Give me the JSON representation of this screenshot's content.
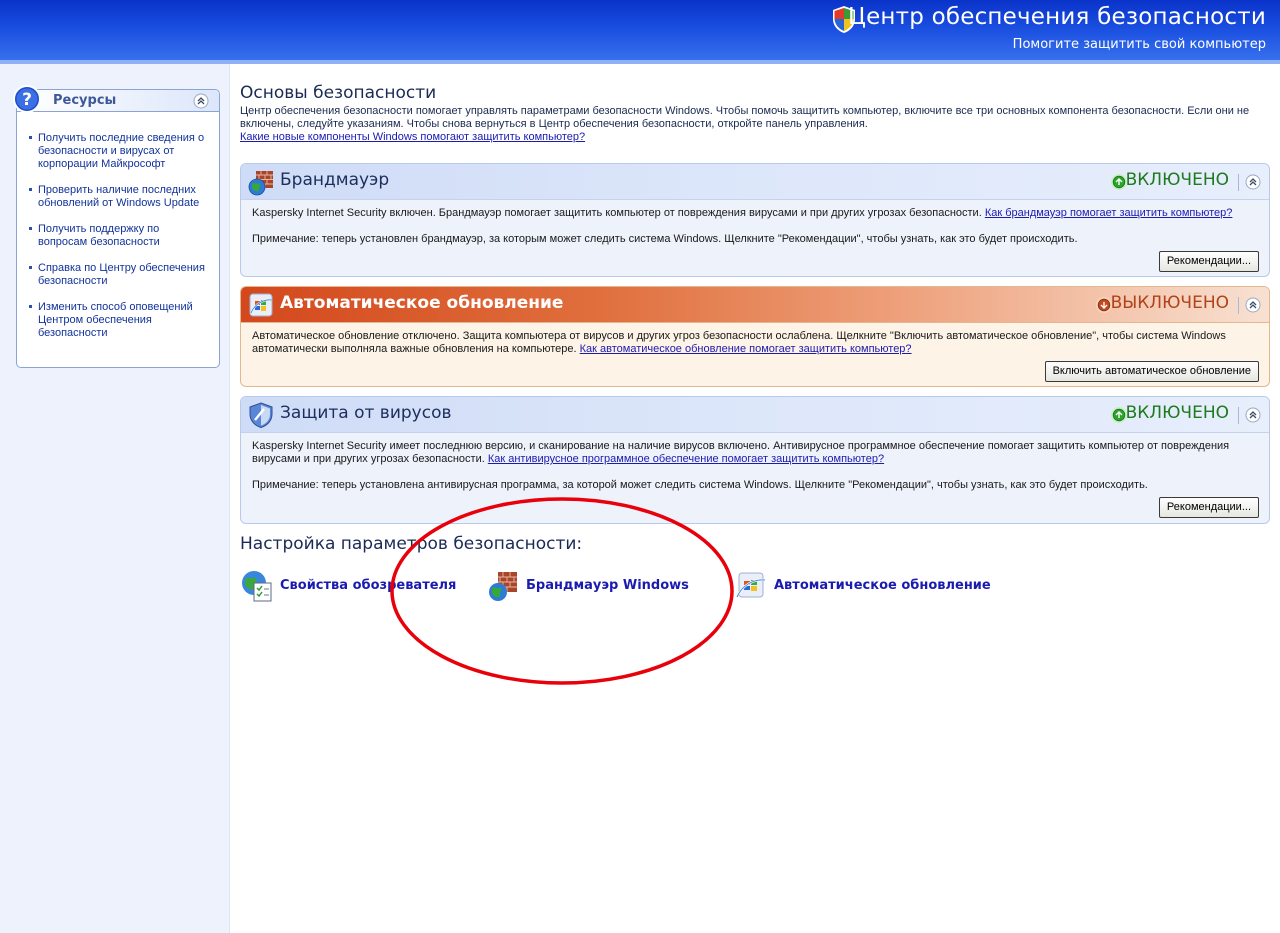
{
  "header": {
    "title": "Центр обеспечения безопасности",
    "subtitle": "Помогите защитить свой компьютер"
  },
  "resources": {
    "title": "Ресурсы",
    "items": [
      {
        "label": "Получить последние сведения о безопасности и вирусах от корпорации Майкрософт"
      },
      {
        "label": "Проверить наличие последних обновлений от Windows Update"
      },
      {
        "label": "Получить поддержку по вопросам безопасности"
      },
      {
        "label": "Справка по Центру обеспечения безопасности"
      },
      {
        "label": "Изменить способ оповещений Центром обеспечения безопасности"
      }
    ]
  },
  "main": {
    "title": "Основы безопасности",
    "description": "Центр обеспечения безопасности помогает управлять параметрами безопасности Windows. Чтобы помочь защитить компьютер, включите все три основных компонента безопасности. Если они не включены, следуйте указаниям. Чтобы снова вернуться в Центр обеспечения безопасности, откройте панель управления.",
    "link": "Какие новые компоненты Windows помогают защитить компьютер?"
  },
  "panels": {
    "firewall": {
      "title": "Брандмауэр",
      "status": "ВКЛЮЧЕНО",
      "text1": "Kaspersky Internet Security включен. Брандмауэр помогает защитить компьютер от повреждения вирусами и при других угрозах безопасности.",
      "link": "Как брандмауэр помогает защитить компьютер?",
      "note": "Примечание: теперь установлен брандмауэр, за которым может следить система Windows.   Щелкните \"Рекомендации\", чтобы узнать, как это будет происходить.",
      "button": "Рекомендации..."
    },
    "autoupdate": {
      "title": "Автоматическое обновление",
      "status": "ВЫКЛЮЧЕНО",
      "text1": "Автоматическое обновление отключено. Защита компьютера от вирусов и других угроз безопасности ослаблена. Щелкните \"Включить автоматическое обновление\", чтобы система Windows автоматически выполняла важные обновления на компьютере.",
      "link": "Как автоматическое обновление помогает защитить компьютер?",
      "button": "Включить автоматическое обновление"
    },
    "antivirus": {
      "title": "Защита от вирусов",
      "status": "ВКЛЮЧЕНО",
      "text1": "Kaspersky Internet Security имеет последнюю версию, и сканирование на наличие вирусов включено. Антивирусное программное обеспечение помогает защитить компьютер от повреждения вирусами и при других угрозах безопасности.",
      "link": "Как антивирусное программное обеспечение помогает защитить компьютер?",
      "note": "Примечание: теперь установлена антивирусная программа, за которой может следить система Windows. Щелкните \"Рекомендации\", чтобы узнать, как это будет происходить.",
      "button": "Рекомендации..."
    }
  },
  "settings": {
    "title": "Настройка параметров безопасности:",
    "items": [
      {
        "label": "Свойства обозревателя",
        "icon": "internet-options-icon"
      },
      {
        "label": "Брандмауэр Windows",
        "icon": "windows-firewall-icon"
      },
      {
        "label": "Автоматическое обновление",
        "icon": "automatic-updates-icon"
      }
    ]
  },
  "colors": {
    "header_blue": "#1a4fe0",
    "status_on": "#1d7a1d",
    "status_off": "#b0431a",
    "link": "#1b1bb0",
    "annotation": "#e8000b"
  }
}
